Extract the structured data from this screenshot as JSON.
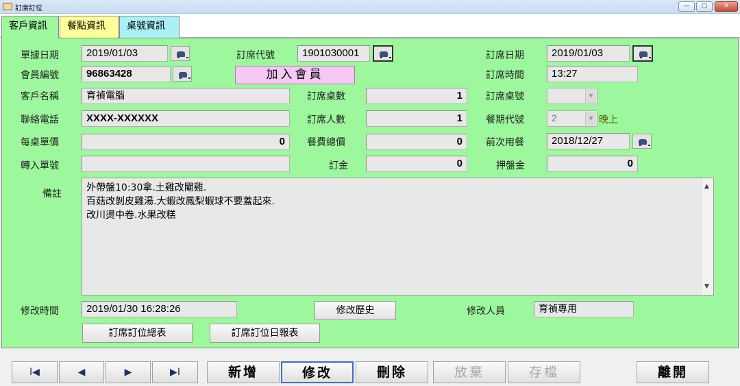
{
  "window": {
    "title": "訂席訂位"
  },
  "tabs": [
    {
      "label": "客戶資訊"
    },
    {
      "label": "餐點資訊"
    },
    {
      "label": "桌號資訊"
    }
  ],
  "form": {
    "doc_date_label": "單據日期",
    "doc_date": "2019/01/03",
    "member_no_label": "會員編號",
    "member_no": "96863428",
    "customer_name_label": "客戶名稱",
    "customer_name": "育禎電腦",
    "phone_label": "聯絡電話",
    "phone": "XXXX-XXXXXX",
    "table_price_label": "每桌單價",
    "table_price": "0",
    "transfer_no_label": "轉入單號",
    "transfer_no": "",
    "booking_code_label": "訂席代號",
    "booking_code": "1901030001",
    "join_member_label": "加入會員",
    "table_count_label": "訂席桌數",
    "table_count": "1",
    "guest_count_label": "訂席人數",
    "guest_count": "1",
    "meal_total_label": "餐費總價",
    "meal_total": "0",
    "deposit_label": "訂金",
    "deposit": "0",
    "booking_date_label": "訂席日期",
    "booking_date": "2019/01/03",
    "booking_time_label": "訂席時間",
    "booking_time": "13:27",
    "table_no_label": "訂席桌號",
    "table_no": "",
    "meal_period_label": "餐期代號",
    "meal_period": "2",
    "meal_period_name": "晚上",
    "last_meal_label": "前次用餐",
    "last_meal": "2018/12/27",
    "plate_deposit_label": "押盤金",
    "plate_deposit": "0",
    "memo_label": "備註",
    "memo_lines": [
      "外帶盤10:30拿.土雞改閹雞.",
      "百菇改剝皮雞湯.大蝦改鳳梨蝦球不要蓋起來.",
      "改川燙中卷.水果改糕"
    ],
    "modified_time_label": "修改時間",
    "modified_time": "2019/01/30 16:28:26",
    "history_button": "修改歷史",
    "modified_by_label": "修改人員",
    "modified_by": "育禎專用",
    "summary_button": "訂席訂位總表",
    "daily_report_button": "訂席訂位日報表"
  },
  "toolbar": {
    "first": "I◀",
    "prev": "◀",
    "next": "▶",
    "last": "▶I",
    "add": "新增",
    "edit": "修改",
    "delete": "刪除",
    "abandon": "放棄",
    "save": "存檔",
    "exit": "離開"
  }
}
